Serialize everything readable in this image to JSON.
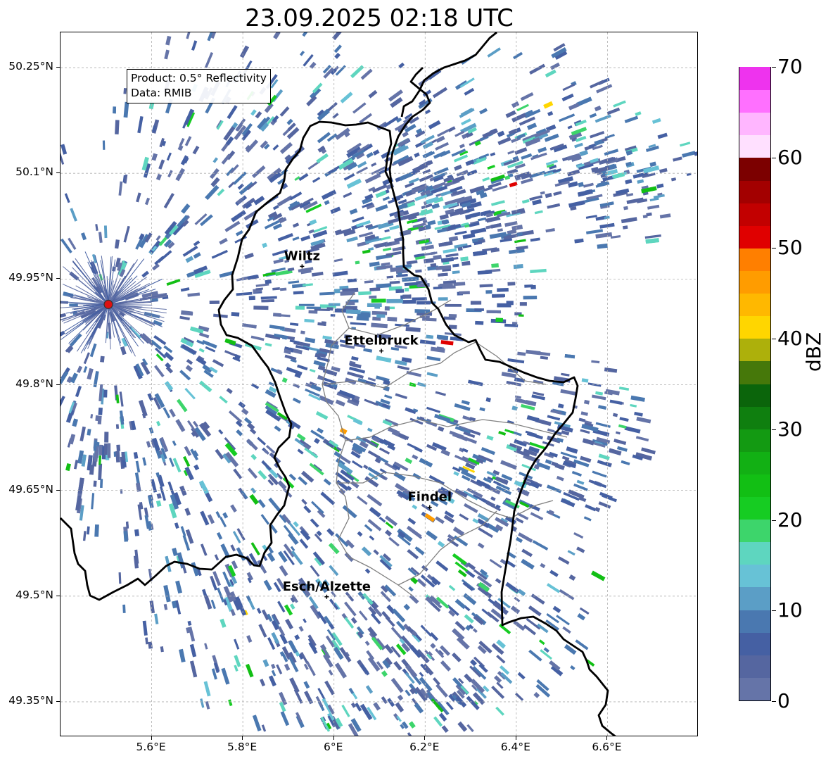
{
  "title": "23.09.2025 02:18 UTC",
  "info": {
    "product": "Product: 0.5° Reflectivity",
    "data_source": "Data: RMIB"
  },
  "axes": {
    "lat_ticks": [
      "50.25°N",
      "50.1°N",
      "49.95°N",
      "49.8°N",
      "49.65°N",
      "49.5°N",
      "49.35°N"
    ],
    "lon_ticks": [
      "5.6°E",
      "5.8°E",
      "6°E",
      "6.2°E",
      "6.4°E",
      "6.6°E"
    ],
    "lat_range": [
      49.3,
      50.3
    ],
    "lon_range": [
      5.4,
      6.8
    ],
    "grid": true
  },
  "cities": [
    {
      "name": "Wiltz",
      "lon": 5.93,
      "lat": 49.968
    },
    {
      "name": "Ettelbruck",
      "lon": 6.104,
      "lat": 49.848
    },
    {
      "name": "Findel",
      "lon": 6.21,
      "lat": 49.626
    },
    {
      "name": "Esch/Alzette",
      "lon": 5.984,
      "lat": 49.499
    }
  ],
  "radar_site": {
    "lon": 5.505,
    "lat": 49.914
  },
  "colorbar": {
    "unit": "dBZ",
    "ticks": [
      "0",
      "10",
      "20",
      "30",
      "40",
      "50",
      "60",
      "70"
    ],
    "range": [
      0,
      70
    ],
    "colors": [
      "#6574a8",
      "#5566a0",
      "#4560a3",
      "#4a78b0",
      "#5b9ec6",
      "#67c2d6",
      "#5ed6bf",
      "#3dd56b",
      "#16cc22",
      "#12bf14",
      "#12b014",
      "#139a12",
      "#0f7f0f",
      "#0b650b",
      "#46780a",
      "#adb00b",
      "#ffd600",
      "#ffb800",
      "#ff9c00",
      "#ff7f00",
      "#e00000",
      "#c20000",
      "#a30000",
      "#7c0000",
      "#ffe0ff",
      "#ffb6ff",
      "#ff70ff",
      "#ee33ee"
    ]
  },
  "colors": {
    "border_national": "#000000",
    "border_canton": "#808080",
    "grid": "#b0b0b0",
    "radar_site_marker": "#dd1111"
  }
}
